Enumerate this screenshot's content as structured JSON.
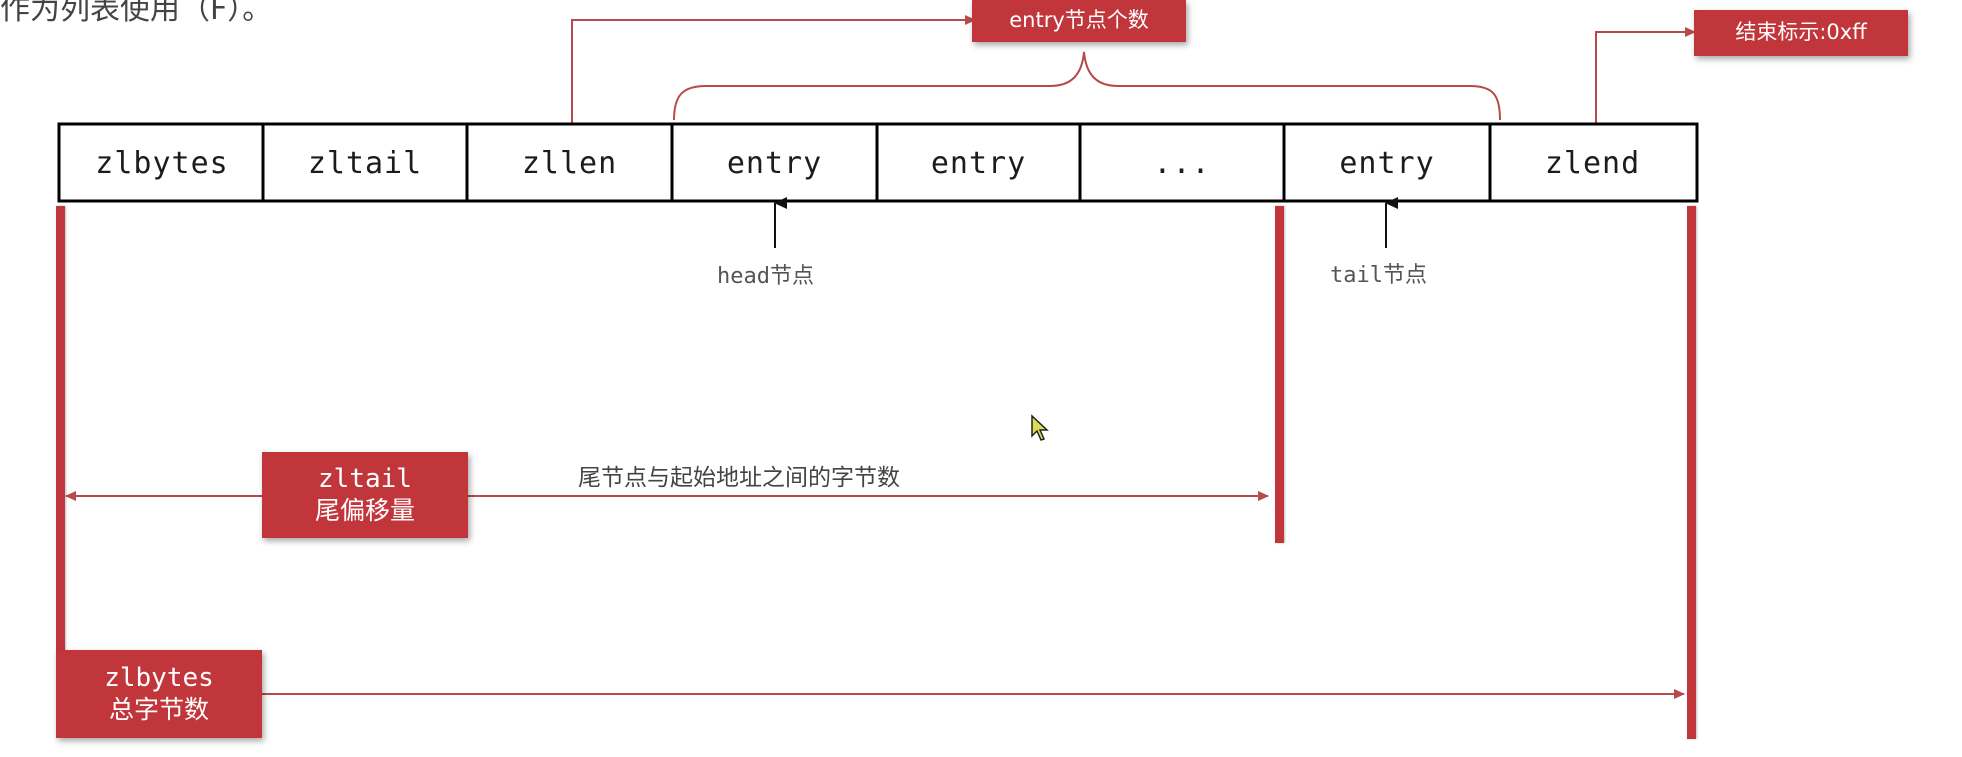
{
  "header_fragment": "作为列表使用（F）。",
  "cells": [
    "zlbytes",
    "zltail",
    "zllen",
    "entry",
    "entry",
    "...",
    "entry",
    "zlend"
  ],
  "callouts": {
    "entry_count": "entry节点个数",
    "end_marker": "结束标示:0xff",
    "zltail_offset_line1": "zltail",
    "zltail_offset_line2": "尾偏移量",
    "zlbytes_total_line1": "zlbytes",
    "zlbytes_total_line2": "总字节数"
  },
  "labels": {
    "head_node": "head节点",
    "tail_node": "tail节点",
    "tail_offset_desc": "尾节点与起始地址之间的字节数"
  },
  "colors": {
    "accent_red": "#c1363a",
    "line_red": "#b94a4a",
    "border": "#000000"
  }
}
